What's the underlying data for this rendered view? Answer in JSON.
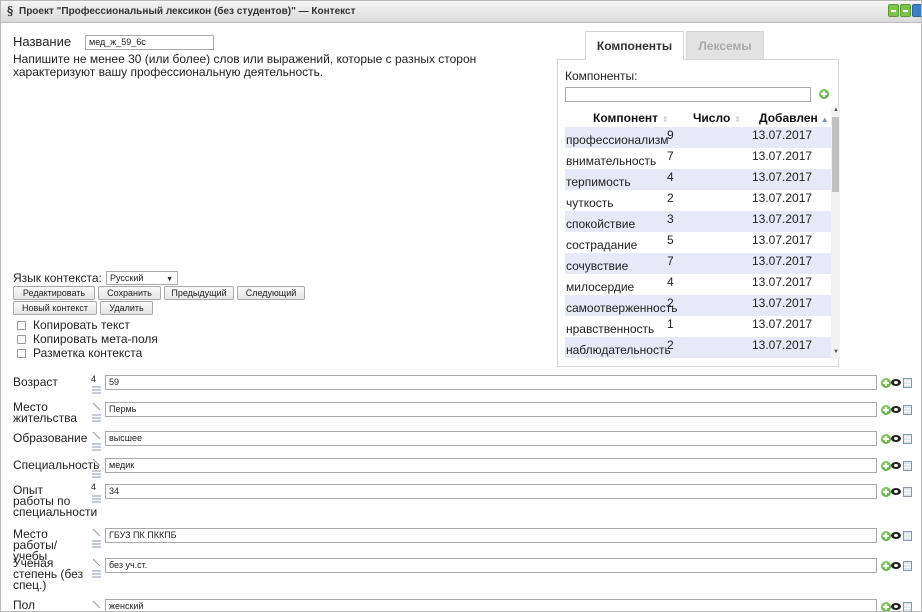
{
  "window": {
    "title_icon": "§",
    "title": "Проект \"Профессиональный лексикон (без студентов)\" — Контекст"
  },
  "name_label": "Название",
  "name_value": "мед_ж_59_6с",
  "instruction": "Напишите не менее 30 (или более) слов или выражений, которые с разных сторон характеризуют вашу профессиональную деятельность.",
  "language": {
    "label": "Язык контекста:",
    "value": "Русский"
  },
  "buttons": {
    "edit": "Редактировать",
    "save": "Сохранить",
    "prev": "Предыдущий",
    "next": "Следующий",
    "new_context": "Новый контекст",
    "delete": "Удалить"
  },
  "checkboxes": {
    "copy_text": "Копировать текст",
    "copy_meta": "Копировать мета-поля",
    "markup": "Разметка контекста"
  },
  "tabs": {
    "components": "Компоненты",
    "lexemes": "Лексемы"
  },
  "components": {
    "label": "Компоненты:",
    "headers": {
      "component": "Компонент",
      "count": "Число",
      "added": "Добавлен"
    },
    "rows": [
      {
        "name": "профессионализм",
        "count": "9",
        "date": "13.07.2017"
      },
      {
        "name": "внимательность",
        "count": "7",
        "date": "13.07.2017"
      },
      {
        "name": "терпимость",
        "count": "4",
        "date": "13.07.2017"
      },
      {
        "name": "чуткость",
        "count": "2",
        "date": "13.07.2017"
      },
      {
        "name": "спокойствие",
        "count": "3",
        "date": "13.07.2017"
      },
      {
        "name": "сострадание",
        "count": "5",
        "date": "13.07.2017"
      },
      {
        "name": "сочувствие",
        "count": "7",
        "date": "13.07.2017"
      },
      {
        "name": "милосердие",
        "count": "4",
        "date": "13.07.2017"
      },
      {
        "name": "самоотверженность",
        "count": "2",
        "date": "13.07.2017"
      },
      {
        "name": "нравственность",
        "count": "1",
        "date": "13.07.2017"
      },
      {
        "name": "наблюдательность",
        "count": "2",
        "date": "13.07.2017"
      }
    ]
  },
  "fields": [
    {
      "label": "Возраст",
      "count": "4",
      "value": "59"
    },
    {
      "label": "Место жительства",
      "count": "",
      "value": "Пермь"
    },
    {
      "label": "Образование",
      "count": "",
      "value": "высшее"
    },
    {
      "label": "Специальность",
      "count": "",
      "value": "медик"
    },
    {
      "label": "Опыт работы по специальности",
      "count": "4",
      "value": "34"
    },
    {
      "label": "Место работы/ учебы",
      "count": "",
      "value": "ГБУЗ ПК ПККПБ"
    },
    {
      "label": "Ученая степень (без спец.)",
      "count": "",
      "value": "без уч.ст."
    },
    {
      "label": "Пол",
      "count": "",
      "value": "женский"
    }
  ],
  "colors": {
    "row_stripe": "#e7e8f8",
    "accent_green": "#45a02b",
    "accent_blue": "#3a80c6"
  }
}
